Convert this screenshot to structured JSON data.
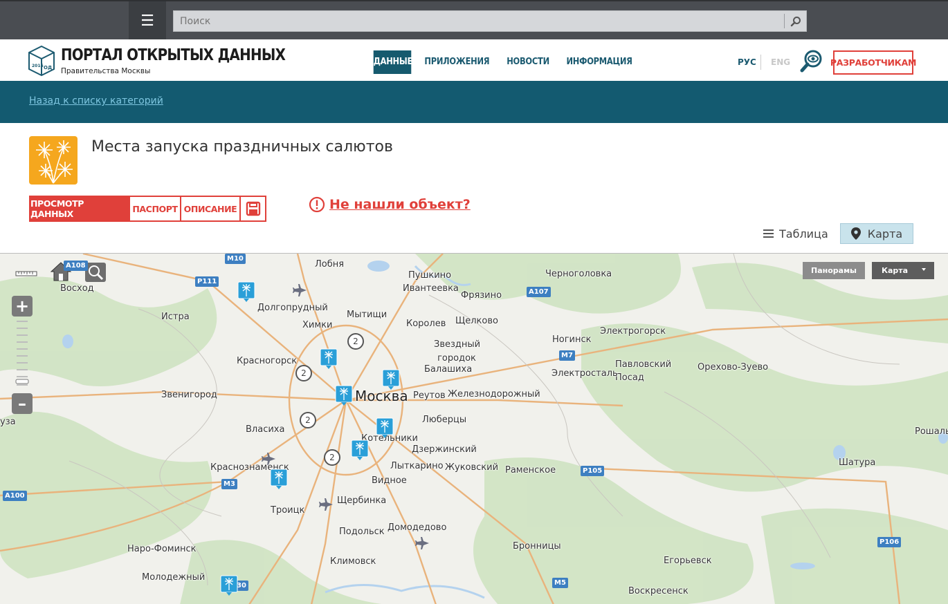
{
  "topbar": {
    "search_placeholder": "Поиск"
  },
  "header": {
    "logo_title": "ПОРТАЛ ОТКРЫТЫХ ДАННЫХ",
    "logo_subtitle": "Правительства Москвы",
    "logo_badge": "ОД",
    "nav": [
      "ДАННЫЕ",
      "ПРИЛОЖЕНИЯ",
      "НОВОСТИ",
      "ИНФОРМАЦИЯ"
    ],
    "lang_ru": "РУС",
    "lang_en": "ENG",
    "developers": "РАЗРАБОТЧИКАМ"
  },
  "breadcrumb": {
    "back": "Назад к списку категорий"
  },
  "dataset": {
    "title": "Места запуска праздничных салютов",
    "tabs": [
      "ПРОСМОТР ДАННЫХ",
      "ПАСПОРТ",
      "ОПИСАНИЕ"
    ],
    "not_found": "Не нашли объект?",
    "view_table": "Таблица",
    "view_map": "Карта"
  },
  "map": {
    "panorama": "Панорамы",
    "map_type": "Карта",
    "cities": [
      "Лобня",
      "Пушкино",
      "Черноголовка",
      "Ивантеевка",
      "Фрязино",
      "Восход",
      "Долгопрудный",
      "Истра",
      "Химки",
      "Мытищи",
      "Королев",
      "Щелково",
      "Звездный городок",
      "Ногинск",
      "Электрогорск",
      "Красногорск",
      "Балашиха",
      "Павловский Посад",
      "Орехово-Зуево",
      "Электросталь",
      "Звенигород",
      "Москва",
      "Реутов",
      "Железнодорожный",
      "Люберцы",
      "Власиха",
      "Котельники",
      "Дзержинский",
      "Лыткарино",
      "Жуковский",
      "Раменское",
      "Краснознаменск",
      "Видное",
      "Щербинка",
      "Троицк",
      "Подольск",
      "Домодедово",
      "Наро-Фоминск",
      "Бронницы",
      "Климовск",
      "Молодежный",
      "Егорьевск",
      "Воскресенск",
      "Шатура",
      "Рошаль",
      "уза"
    ],
    "roads": [
      "М10",
      "А108",
      "Р111",
      "А107",
      "М7",
      "М3",
      "А100",
      "Р105",
      "Р106",
      "М5",
      "30"
    ],
    "clusters": [
      "2",
      "2",
      "2",
      "2"
    ]
  }
}
